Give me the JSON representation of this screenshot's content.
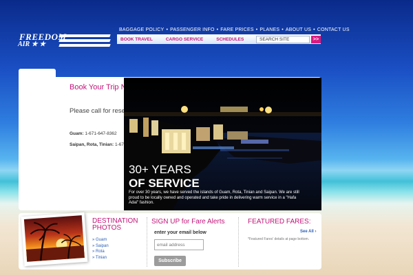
{
  "logo": {
    "line1": "FREEDOM",
    "line2": "AIR ★ ★"
  },
  "topnav": [
    "BAGGAGE POLICY",
    "PASSENGER INFO",
    "FARE PRICES",
    "PLANES",
    "ABOUT US",
    "CONTACT US"
  ],
  "subnav": {
    "tabs": [
      "BOOK TRAVEL",
      "CARGO SERVICE",
      "SCHEDULES"
    ],
    "search_value": "SEARCH SITE",
    "search_go": ">>"
  },
  "booking": {
    "title": "Book Your Trip N",
    "please_call": "Please call for rese",
    "phones": [
      {
        "label": "Guam:",
        "value": "1-671-647-8362"
      },
      {
        "label": "Saipan, Rota, Tinian:",
        "value": "1-67"
      }
    ]
  },
  "hero": {
    "line1": "30+ YEARS",
    "line2": "OF SERVICE",
    "text": "For over 30 years, we have served the islands of Guam, Rota, Tinian and Saipan. We are still proud to be locally owned and operated and take pride in delivering warm service in a \"Hafa Adai\" fashion."
  },
  "destinations": {
    "title_line1": "DESTINATION",
    "title_line2": "PHOTOS",
    "items": [
      "» Guam",
      "» Saipan",
      "» Rota",
      "» Tinian"
    ]
  },
  "signup": {
    "title": "SIGN UP for Fare Alerts",
    "label": "enter your email below",
    "placeholder": "email address",
    "button": "Subscribe"
  },
  "fares": {
    "title": "FEATURED FARES:",
    "see_all": "See All ›",
    "note": "*Featured Fares' details at page bottom."
  },
  "colors": {
    "accent": "#c2147a",
    "link": "#2a5fb8"
  }
}
